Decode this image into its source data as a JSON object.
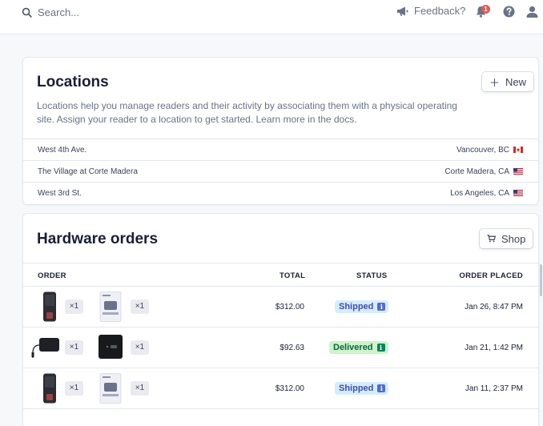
{
  "topbar": {
    "search_placeholder": "Search...",
    "feedback_label": "Feedback?",
    "notification_count": "1"
  },
  "locations": {
    "title": "Locations",
    "new_button": "New",
    "description": "Locations help you manage readers and their activity by associating them with a physical operating site. Assign your reader to a location to get started. Learn more in the docs.",
    "rows": [
      {
        "name": "West 4th Ave.",
        "city": "Vancouver, BC",
        "flag": "Canada"
      },
      {
        "name": "The Village at Corte Madera",
        "city": "Corte Madera, CA",
        "flag": "United States"
      },
      {
        "name": "West 3rd St.",
        "city": "Los Angeles, CA",
        "flag": "United States"
      }
    ]
  },
  "hardware_orders": {
    "title": "Hardware orders",
    "shop_button": "Shop",
    "columns": {
      "order": "ORDER",
      "total": "TOTAL",
      "status": "STATUS",
      "placed": "ORDER PLACED"
    },
    "rows": [
      {
        "items": [
          {
            "device": "card-reader-handheld",
            "qty": "×1"
          },
          {
            "device": "reader-box",
            "qty": "×1"
          }
        ],
        "total": "$312.00",
        "status": "Shipped",
        "status_color": "#5469d4",
        "placed": "Jan 26, 8:47 PM"
      },
      {
        "items": [
          {
            "device": "card-reader-with-cable",
            "qty": "×1"
          },
          {
            "device": "countertop-reader",
            "qty": "×1"
          }
        ],
        "total": "$92.63",
        "status": "Delivered",
        "status_color": "#09825d",
        "placed": "Jan 21, 1:42 PM"
      },
      {
        "items": [
          {
            "device": "card-reader-handheld",
            "qty": "×1"
          },
          {
            "device": "reader-box",
            "qty": "×1"
          }
        ],
        "total": "$312.00",
        "status": "Shipped",
        "status_color": "#5469d4",
        "placed": "Jan 11, 2:37 PM"
      }
    ]
  },
  "colors": {
    "accent": "#5469d4",
    "text": "#1a1f36",
    "muted": "#697386",
    "border": "#e3e8ee"
  }
}
